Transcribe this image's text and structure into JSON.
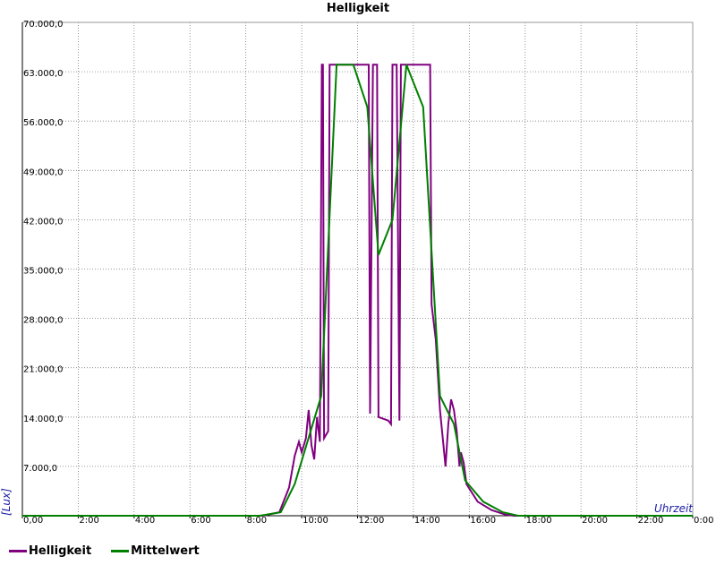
{
  "chart_data": {
    "type": "line",
    "title": "Helligkeit",
    "xlabel": "Uhrzeit",
    "ylabel": "[Lux]",
    "xlim": [
      0,
      24
    ],
    "ylim": [
      0,
      70000
    ],
    "grid": true,
    "legend_position": "bottom-left",
    "x_ticks": [
      0,
      2,
      4,
      6,
      8,
      10,
      12,
      14,
      16,
      18,
      20,
      22,
      24
    ],
    "x_tick_labels": [
      "0,00",
      "2:00",
      "4:00",
      "6:00",
      "8:00",
      "10:00",
      "12:00",
      "14:00",
      "16:00",
      "18:00",
      "20:00",
      "22:00",
      "0:00"
    ],
    "y_ticks": [
      7000,
      14000,
      21000,
      28000,
      35000,
      42000,
      49000,
      56000,
      63000,
      70000
    ],
    "y_tick_labels": [
      "7.000,0",
      "14.000,0",
      "21.000,0",
      "28.000,0",
      "35.000,0",
      "42.000,0",
      "49.000,0",
      "56.000,0",
      "63.000,0",
      "70.000,0"
    ],
    "series": [
      {
        "name": "Helligkeit",
        "color": "#800080",
        "points": [
          [
            0,
            0
          ],
          [
            8.6,
            0
          ],
          [
            9.2,
            500
          ],
          [
            9.55,
            4000
          ],
          [
            9.75,
            8500
          ],
          [
            9.9,
            10500
          ],
          [
            10.0,
            9000
          ],
          [
            10.15,
            11000
          ],
          [
            10.25,
            15000
          ],
          [
            10.35,
            10000
          ],
          [
            10.45,
            8000
          ],
          [
            10.55,
            14000
          ],
          [
            10.65,
            10500
          ],
          [
            10.72,
            64000
          ],
          [
            10.76,
            64000
          ],
          [
            10.8,
            11000
          ],
          [
            10.95,
            12000
          ],
          [
            11.0,
            64000
          ],
          [
            11.05,
            64000
          ],
          [
            11.15,
            64000
          ],
          [
            12.2,
            64000
          ],
          [
            12.4,
            64000
          ],
          [
            12.45,
            14500
          ],
          [
            12.55,
            64000
          ],
          [
            12.7,
            64000
          ],
          [
            12.75,
            14000
          ],
          [
            13.1,
            13500
          ],
          [
            13.2,
            13000
          ],
          [
            13.25,
            64000
          ],
          [
            13.4,
            64000
          ],
          [
            13.5,
            13500
          ],
          [
            13.55,
            64000
          ],
          [
            14.6,
            64000
          ],
          [
            14.65,
            30000
          ],
          [
            14.8,
            25000
          ],
          [
            14.95,
            15000
          ],
          [
            15.15,
            7000
          ],
          [
            15.25,
            13000
          ],
          [
            15.35,
            16500
          ],
          [
            15.45,
            15000
          ],
          [
            15.55,
            12000
          ],
          [
            15.65,
            7000
          ],
          [
            15.7,
            9000
          ],
          [
            15.8,
            7500
          ],
          [
            15.9,
            4500
          ],
          [
            16.3,
            2000
          ],
          [
            16.8,
            800
          ],
          [
            17.3,
            150
          ],
          [
            17.6,
            0
          ],
          [
            24,
            0
          ]
        ]
      },
      {
        "name": "Mittelwert",
        "color": "#008000",
        "points": [
          [
            0,
            0
          ],
          [
            8.5,
            0
          ],
          [
            9.25,
            500
          ],
          [
            9.75,
            4500
          ],
          [
            10.7,
            17000
          ],
          [
            11.25,
            64000
          ],
          [
            11.85,
            64000
          ],
          [
            12.35,
            58000
          ],
          [
            12.75,
            37000
          ],
          [
            13.25,
            42000
          ],
          [
            13.75,
            64000
          ],
          [
            14.35,
            58000
          ],
          [
            14.95,
            17000
          ],
          [
            15.45,
            13000
          ],
          [
            15.85,
            5000
          ],
          [
            16.5,
            2000
          ],
          [
            17.2,
            500
          ],
          [
            17.75,
            0
          ],
          [
            24,
            0
          ]
        ]
      }
    ]
  }
}
